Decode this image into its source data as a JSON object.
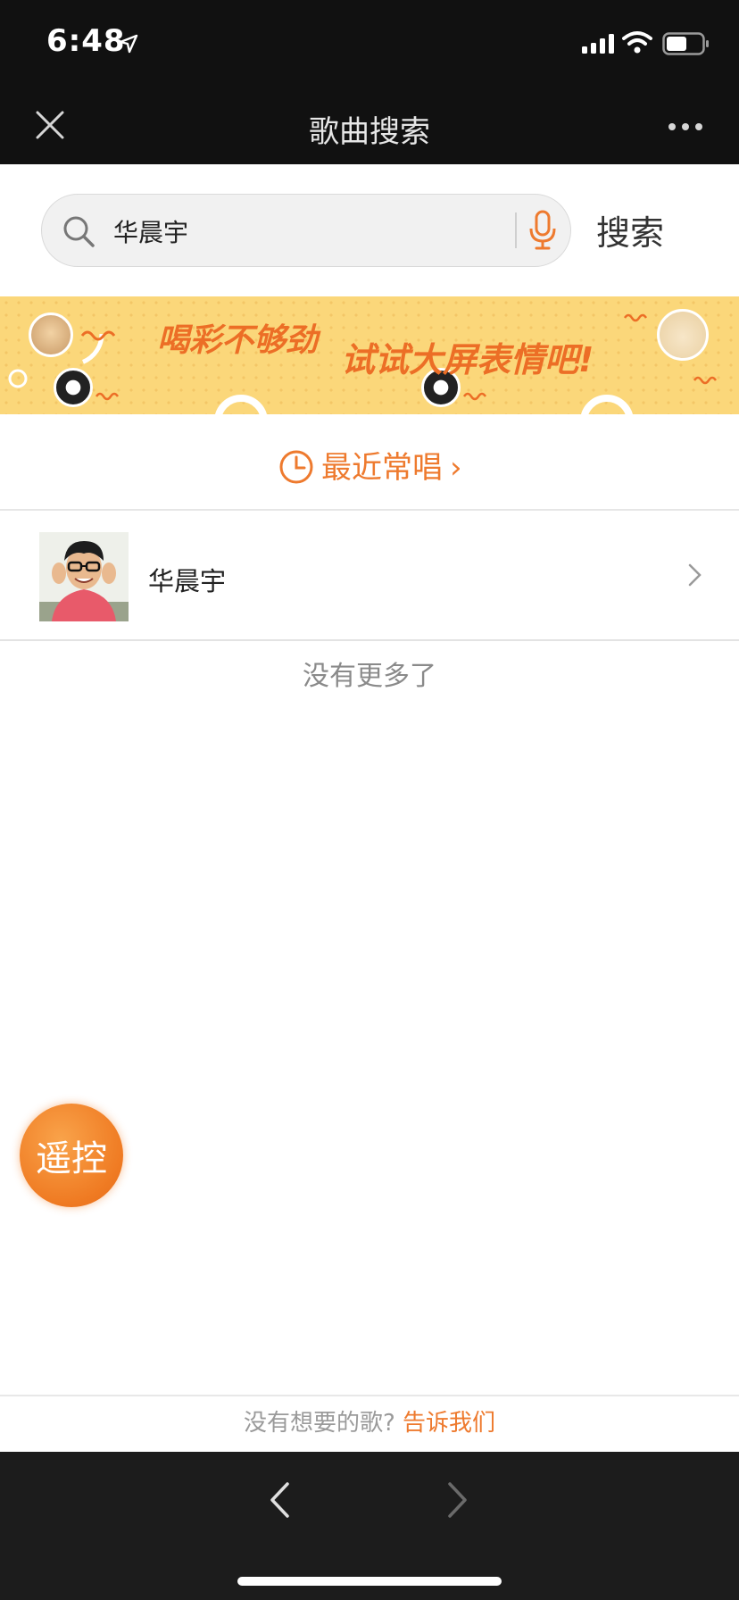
{
  "status_bar": {
    "time": "6:48"
  },
  "nav": {
    "title": "歌曲搜索"
  },
  "search": {
    "value": "华晨宇",
    "button_label": "搜索"
  },
  "banner": {
    "text_1": "喝彩不够劲",
    "text_2": "试试大屏表情吧!"
  },
  "recent": {
    "label": "最近常唱",
    "arrow": "›"
  },
  "results": [
    {
      "name": "华晨宇"
    }
  ],
  "list_end_text": "没有更多了",
  "remote_button": {
    "label": "遥控"
  },
  "feedback": {
    "question": "没有想要的歌?",
    "link": "告诉我们"
  },
  "colors": {
    "accent": "#ee7a2e",
    "nav_bg": "#111111",
    "banner_bg": "#fbd77a"
  }
}
